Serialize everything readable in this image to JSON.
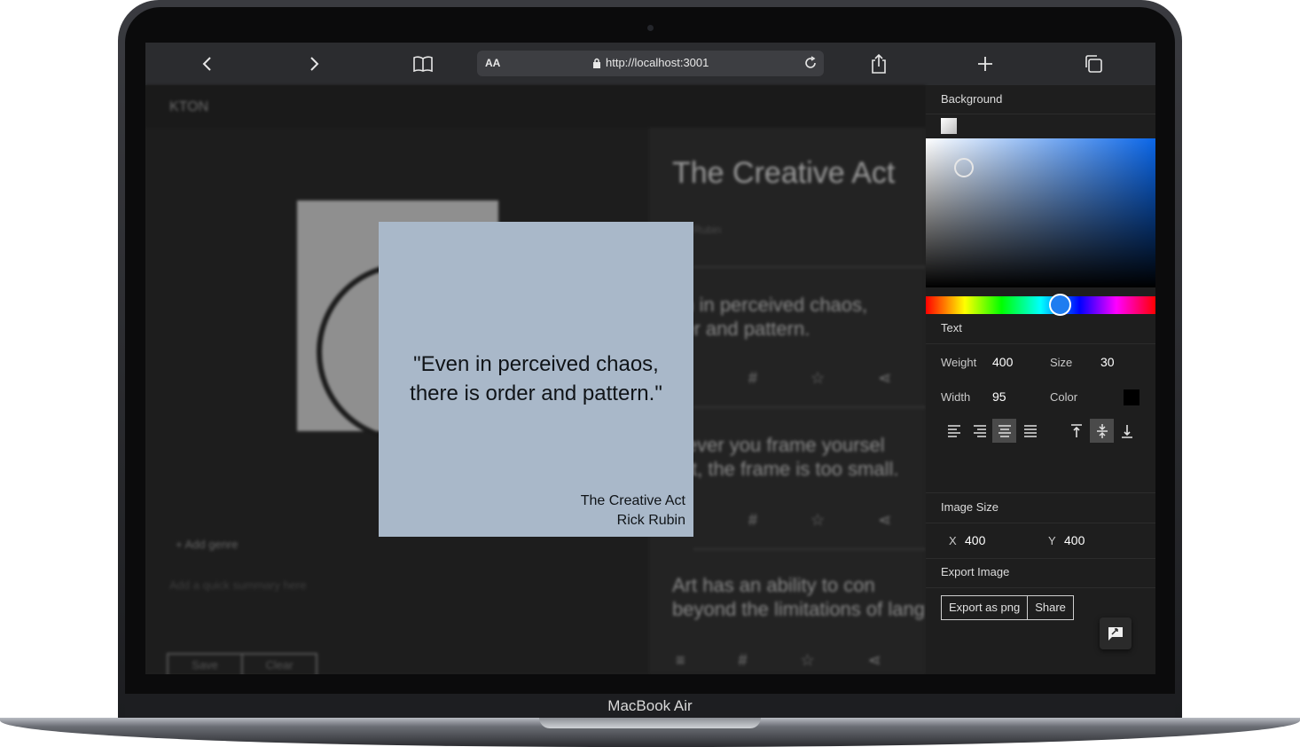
{
  "device": {
    "label": "MacBook Air"
  },
  "browser": {
    "text_size_label": "AA",
    "url": "http://localhost:3001"
  },
  "page": {
    "logo": "KTON",
    "add_genre": "+ Add genre",
    "summary_placeholder": "Add a quick summary here",
    "save_label": "Save",
    "clear_label": "Clear",
    "book_title": "The Creative Act",
    "author_partial": "Rubin",
    "quote_items": [
      {
        "line1": "en in perceived chaos,",
        "line2": "der and pattern."
      },
      {
        "line1": "wever you frame yoursel",
        "line2": "tist, the frame is too small."
      },
      {
        "line1": "Art has an ability to con",
        "line2": "beyond the limitations of lang"
      }
    ]
  },
  "card": {
    "quote_line1": "\"Even in perceived chaos,",
    "quote_line2": "there is order and pattern.\"",
    "book": "The Creative Act",
    "author": "Rick Rubin",
    "background_color": "#a9b8c9"
  },
  "panel": {
    "background_title": "Background",
    "text_title": "Text",
    "weight_label": "Weight",
    "weight_value": "400",
    "size_label": "Size",
    "size_value": "30",
    "width_label": "Width",
    "width_value": "95",
    "color_label": "Color",
    "text_color": "#000000",
    "image_size_title": "Image Size",
    "x_label": "X",
    "x_value": "400",
    "y_label": "Y",
    "y_value": "400",
    "export_title": "Export Image",
    "export_png_label": "Export as png",
    "share_label": "Share",
    "hue_color": "#1f7df0"
  }
}
